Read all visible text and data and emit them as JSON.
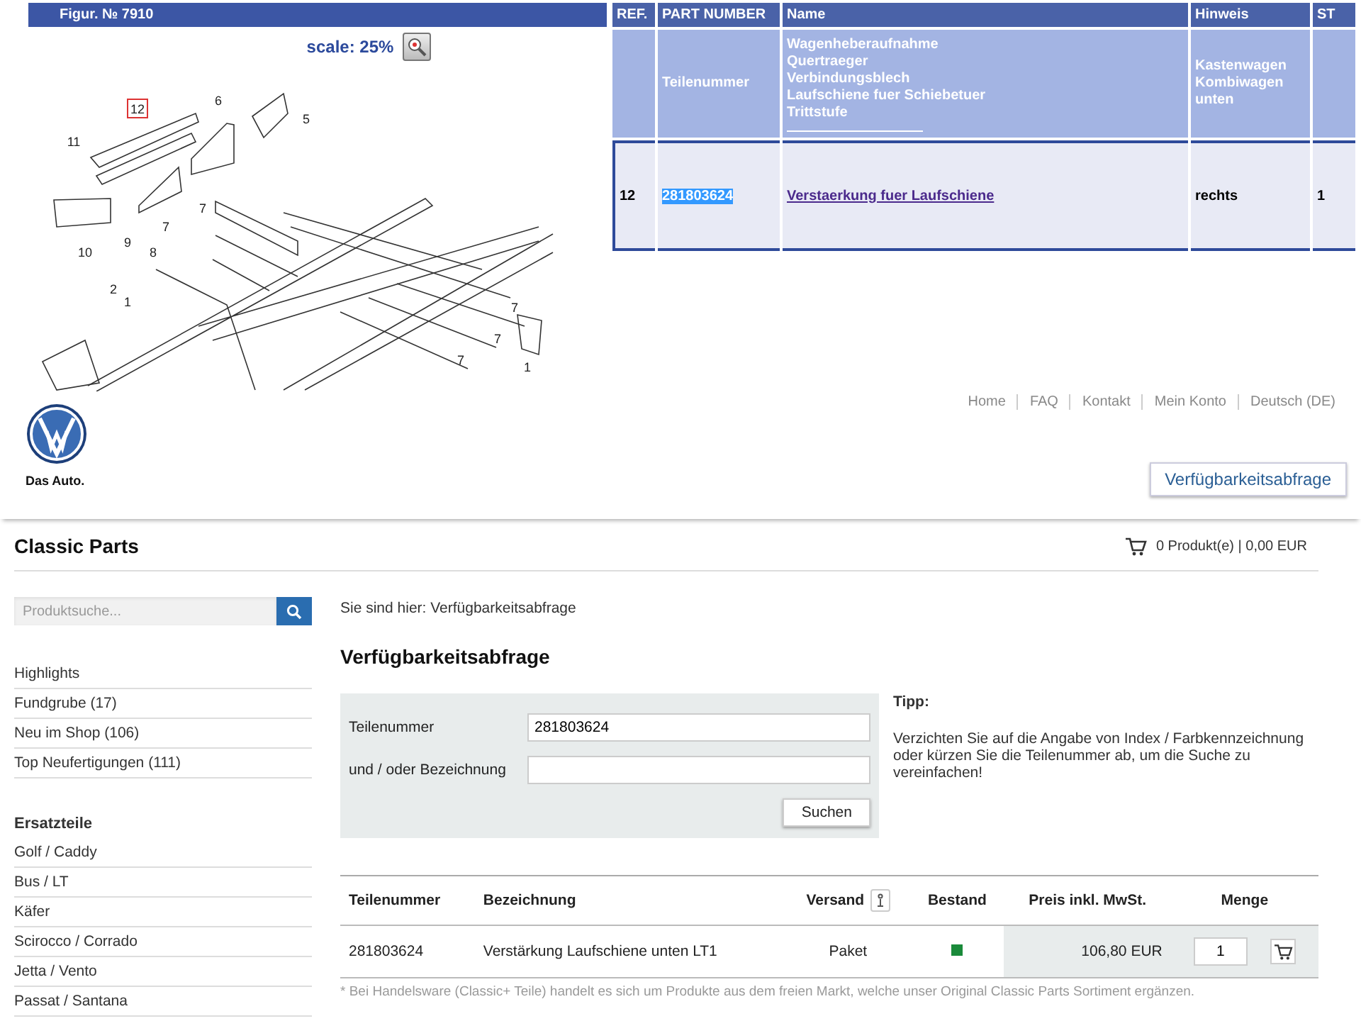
{
  "figure": {
    "title": "Figur. № 7910",
    "scale_label": "scale: 25%",
    "callouts": [
      {
        "label": "12",
        "selected": true
      },
      {
        "label": "6",
        "selected": false
      },
      {
        "label": "5",
        "selected": false
      },
      {
        "label": "11",
        "selected": false
      },
      {
        "label": "10",
        "selected": false
      },
      {
        "label": "9",
        "selected": false
      },
      {
        "label": "7",
        "selected": false
      },
      {
        "label": "7",
        "selected": false
      },
      {
        "label": "8",
        "selected": false
      },
      {
        "label": "2",
        "selected": false
      },
      {
        "label": "1",
        "selected": false
      },
      {
        "label": "7",
        "selected": false
      },
      {
        "label": "7",
        "selected": false
      },
      {
        "label": "7",
        "selected": false
      },
      {
        "label": "1",
        "selected": false
      }
    ]
  },
  "parts_table": {
    "columns": [
      "REF.",
      "PART NUMBER",
      "Name",
      "Hinweis",
      "ST"
    ],
    "filter_row": {
      "part_number": "Teilenummer",
      "names": [
        "Wagenheberaufnahme",
        "Quertraeger",
        "Verbindungsblech",
        "Laufschiene fuer Schiebetuer",
        "Trittstufe"
      ],
      "notes": [
        "Kastenwagen",
        "Kombiwagen",
        "unten"
      ]
    },
    "rows": [
      {
        "ref": "12",
        "part_number": "281803624",
        "highlighted": true,
        "name": "Verstaerkung fuer Laufschiene",
        "note": "rechts",
        "column_5": "1"
      }
    ]
  },
  "top_nav": [
    "Home",
    "FAQ",
    "Kontakt",
    "Mein Konto",
    "Deutsch (DE)"
  ],
  "brand": {
    "tagline": "Das Auto."
  },
  "header_button": "Verfügbarkeitsabfrage",
  "shop": {
    "title": "Classic Parts",
    "cart": "0 Produkt(e) | 0,00 EUR"
  },
  "sidebar": {
    "search_placeholder": "Produktsuche...",
    "highlights": [
      "Highlights",
      "Fundgrube (17)",
      "Neu im Shop (106)",
      "Top Neufertigungen (111)"
    ],
    "section_title": "Ersatzteile",
    "models": [
      "Golf / Caddy",
      "Bus / LT",
      "Käfer",
      "Scirocco / Corrado",
      "Jetta / Vento",
      "Passat / Santana"
    ]
  },
  "breadcrumb": "Sie sind hier: Verfügbarkeitsabfrage",
  "heading": "Verfügbarkeitsabfrage",
  "form": {
    "fields": [
      {
        "label": "Teilenummer",
        "value": "281803624"
      },
      {
        "label": "und / oder Bezeichnung"
      }
    ],
    "submit": "Suchen"
  },
  "tip": {
    "title": "Tipp:",
    "text": "Verzichten Sie auf die Angabe von Index / Farbkennzeichnung oder kürzen Sie die Teilenummer ab, um die Suche zu vereinfachen!"
  },
  "results": {
    "columns": [
      "Teilenummer",
      "Bezeichnung",
      "Versand",
      "Bestand",
      "Preis inkl. MwSt.",
      "Menge"
    ],
    "rows": [
      {
        "part_number": "281803624",
        "description": "Verstärkung Laufschiene unten LT1",
        "shipping": "Paket",
        "color": "#1a8a3a",
        "price": "106,80 EUR",
        "quantity": "1"
      }
    ]
  },
  "footnote": "* Bei Handelsware (Classic+ Teile) handelt es sich um Produkte aus dem freien Markt, welche unser Original Classic Parts Sortiment ergänzen."
}
